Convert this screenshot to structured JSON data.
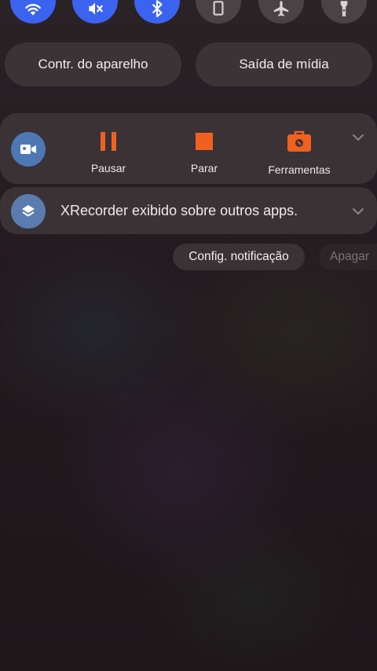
{
  "quick_toggles": [
    {
      "icon": "wifi-icon",
      "state": "on"
    },
    {
      "icon": "sound-mute-icon",
      "state": "on"
    },
    {
      "icon": "bluetooth-icon",
      "state": "on"
    },
    {
      "icon": "rotation-lock-icon",
      "state": "off"
    },
    {
      "icon": "airplane-icon",
      "state": "off"
    },
    {
      "icon": "flashlight-icon",
      "state": "off"
    }
  ],
  "pills": {
    "device_control": "Contr. do aparelho",
    "media_output": "Saída de mídia"
  },
  "recorder_notification": {
    "app_icon": "video-camera-icon",
    "actions": [
      {
        "label": "Pausar",
        "icon": "pause-icon"
      },
      {
        "label": "Parar",
        "icon": "stop-icon"
      },
      {
        "label": "Ferramentas",
        "icon": "toolbox-icon"
      }
    ],
    "accent_color": "#f0611f"
  },
  "overlay_notification": {
    "app_icon": "layers-icon",
    "text": "XRecorder exibido sobre outros apps."
  },
  "footer_buttons": {
    "settings": "Config. notificação",
    "clear": "Apagar"
  },
  "colors": {
    "toggle_on": "#3a63f0",
    "card_bg": "#3a3235"
  }
}
